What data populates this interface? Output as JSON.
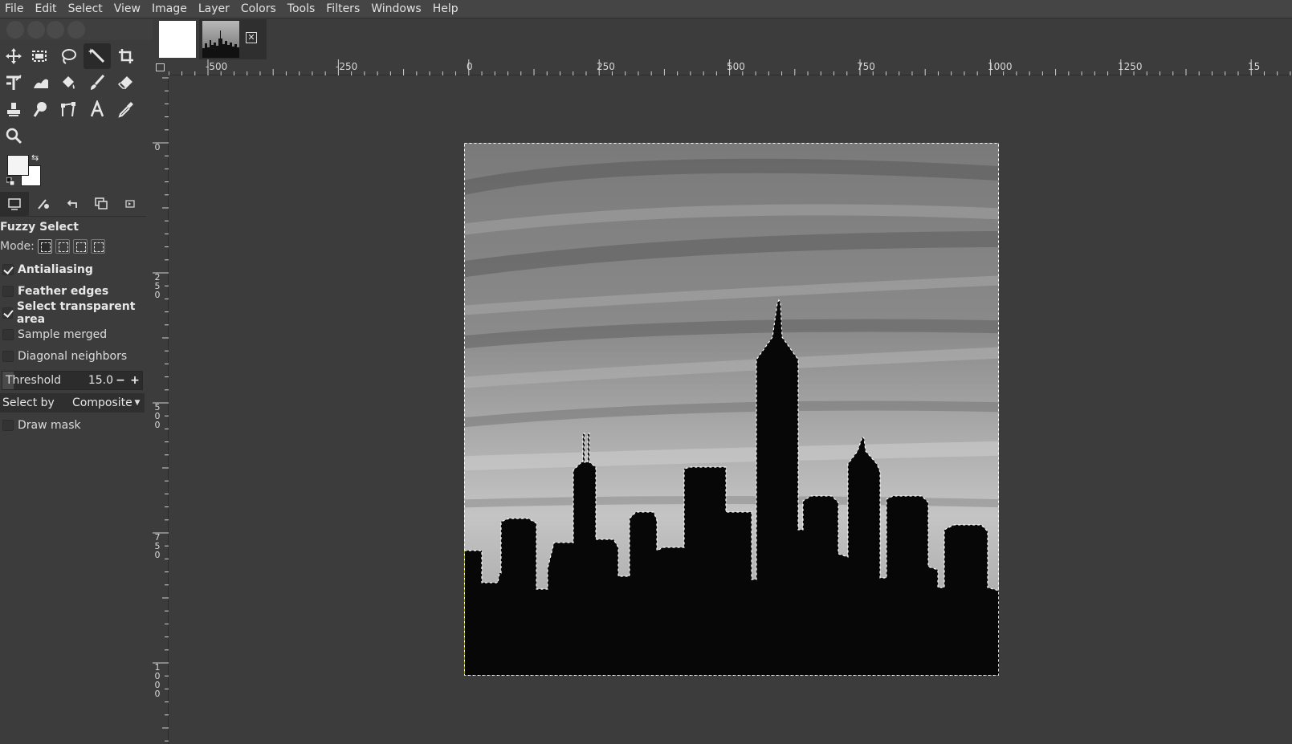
{
  "menubar": {
    "items": [
      "File",
      "Edit",
      "Select",
      "View",
      "Image",
      "Layer",
      "Colors",
      "Tools",
      "Filters",
      "Windows",
      "Help"
    ]
  },
  "toolbox": {
    "tools": [
      "move-tool",
      "rect-select-tool",
      "free-select-tool",
      "fuzzy-select-tool",
      "crop-tool",
      "unified-transform-tool",
      "warp-transform-tool",
      "bucket-fill-tool",
      "paintbrush-tool",
      "eraser-tool",
      "clone-tool",
      "smudge-tool",
      "paths-tool",
      "text-tool",
      "color-picker-tool",
      "zoom-tool"
    ],
    "active_tool": "fuzzy-select-tool",
    "foreground_color": "#f4f4f4",
    "background_color": "#ffffff"
  },
  "tool_options": {
    "title": "Fuzzy Select",
    "mode_label": "Mode:",
    "checks": [
      {
        "label": "Antialiasing",
        "checked": true,
        "bold": true
      },
      {
        "label": "Feather edges",
        "checked": false,
        "bold": true
      },
      {
        "label": "Select transparent area",
        "checked": true,
        "bold": true
      },
      {
        "label": "Sample merged",
        "checked": false,
        "bold": false
      },
      {
        "label": "Diagonal neighbors",
        "checked": false,
        "bold": false
      }
    ],
    "threshold": {
      "label": "Threshold",
      "value": "15.0",
      "minus": "−",
      "plus": "+"
    },
    "select_by": {
      "label": "Select by",
      "value": "Composite"
    },
    "draw_mask": {
      "label": "Draw mask",
      "checked": false
    }
  },
  "rulers": {
    "horizontal": [
      "-500",
      "-250",
      "0",
      "250",
      "500",
      "750",
      "1000",
      "1250",
      "15"
    ],
    "vertical": [
      "0",
      "250",
      "500",
      "750",
      "1000"
    ]
  },
  "colors": {
    "menubar_bg": "#454545",
    "panel_bg": "#3c3c3c",
    "selection_ants": "#ffffff"
  }
}
